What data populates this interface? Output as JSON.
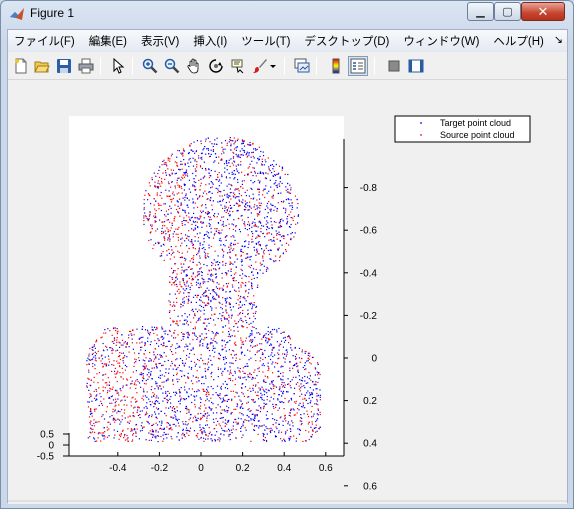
{
  "window": {
    "title": "Figure 1"
  },
  "menu": [
    "ファイル(F)",
    "編集(E)",
    "表示(V)",
    "挿入(I)",
    "ツール(T)",
    "デスクトップ(D)",
    "ウィンドウ(W)",
    "ヘルプ(H)"
  ],
  "toolbar": [
    {
      "icon": "new-figure-icon"
    },
    {
      "icon": "open-file-icon"
    },
    {
      "icon": "save-icon"
    },
    {
      "icon": "print-icon"
    },
    {
      "icon": "edit-plot-arrow-icon"
    },
    {
      "icon": "zoom-in-icon"
    },
    {
      "icon": "zoom-out-icon"
    },
    {
      "icon": "pan-hand-icon"
    },
    {
      "icon": "rotate-3d-icon"
    },
    {
      "icon": "data-cursor-icon"
    },
    {
      "icon": "brush-icon"
    },
    {
      "icon": "brush-dropdown-icon"
    },
    {
      "icon": "link-plot-icon"
    },
    {
      "icon": "insert-colorbar-icon"
    },
    {
      "icon": "insert-legend-icon"
    },
    {
      "icon": "hide-plot-tools-icon"
    },
    {
      "icon": "show-plot-tools-icon"
    }
  ],
  "chart_data": {
    "type": "scatter",
    "title": "",
    "series": [
      {
        "name": "Target point cloud",
        "color": "#0000ff"
      },
      {
        "name": "Source point cloud",
        "color": "#ff0000"
      }
    ],
    "x_axis": {
      "ticks": [
        "-0.4",
        "-0.2",
        "0",
        "0.2",
        "0.4",
        "0.6"
      ],
      "values": [
        -0.4,
        -0.2,
        0,
        0.2,
        0.4,
        0.6
      ]
    },
    "y_axis_right": {
      "ticks": [
        "-0.8",
        "-0.6",
        "-0.4",
        "-0.2",
        "0",
        "0.2",
        "0.4",
        "0.6"
      ],
      "values": [
        -0.8,
        -0.6,
        -0.4,
        -0.2,
        0,
        0.2,
        0.4,
        0.6
      ]
    },
    "z_axis": {
      "ticks": [
        "0.5",
        "0",
        "-0.5"
      ],
      "values": [
        0.5,
        0,
        -0.5
      ]
    },
    "legend_position": "top-right",
    "view": "3d"
  }
}
